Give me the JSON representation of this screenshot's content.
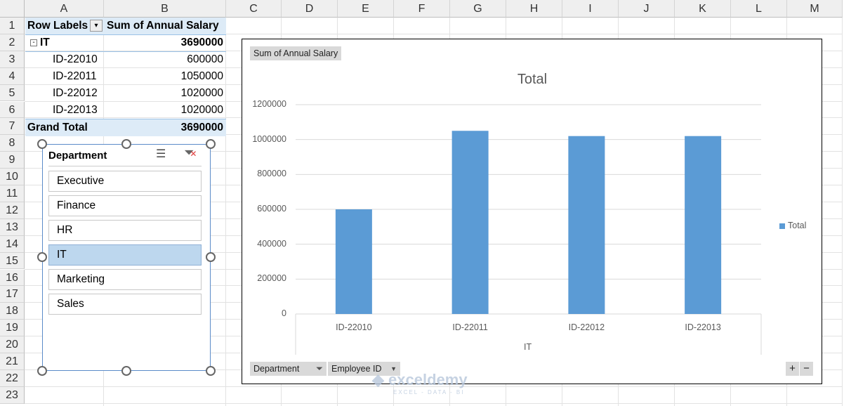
{
  "columns": [
    "A",
    "B",
    "C",
    "D",
    "E",
    "F",
    "G",
    "H",
    "I",
    "J",
    "K",
    "L",
    "M"
  ],
  "rows": [
    "1",
    "2",
    "3",
    "4",
    "5",
    "6",
    "7",
    "8",
    "9",
    "10",
    "11",
    "12",
    "13",
    "14",
    "15",
    "16",
    "17",
    "18",
    "19",
    "20",
    "21",
    "22",
    "23"
  ],
  "pivot": {
    "header": {
      "row_labels": "Row Labels",
      "value": "Sum of Annual Salary"
    },
    "group": {
      "label": "IT",
      "value": "3690000"
    },
    "items": [
      {
        "label": "ID-22010",
        "value": "600000"
      },
      {
        "label": "ID-22011",
        "value": "1050000"
      },
      {
        "label": "ID-22012",
        "value": "1020000"
      },
      {
        "label": "ID-22013",
        "value": "1020000"
      }
    ],
    "grand_total": {
      "label": "Grand Total",
      "value": "3690000"
    }
  },
  "slicer": {
    "title": "Department",
    "items": [
      "Executive",
      "Finance",
      "HR",
      "IT",
      "Marketing",
      "Sales"
    ],
    "selected": "IT",
    "selected_color": "#bdd7ee"
  },
  "chart": {
    "value_button": "Sum of Annual Salary",
    "axis_buttons": [
      "Department",
      "Employee ID"
    ],
    "zoom_buttons": [
      "+",
      "−"
    ]
  },
  "chart_data": {
    "type": "bar",
    "title": "Total",
    "categories": [
      "ID-22010",
      "ID-22011",
      "ID-22012",
      "ID-22013"
    ],
    "group_label": "IT",
    "series": [
      {
        "name": "Total",
        "values": [
          600000,
          1050000,
          1020000,
          1020000
        ],
        "color": "#5b9bd5"
      }
    ],
    "yticks": [
      "0",
      "200000",
      "400000",
      "600000",
      "800000",
      "1000000",
      "1200000"
    ],
    "ylim": [
      0,
      1200000
    ],
    "legend": "right"
  },
  "watermark": {
    "brand": "exceldemy",
    "tagline": "EXCEL - DATA - BI"
  }
}
